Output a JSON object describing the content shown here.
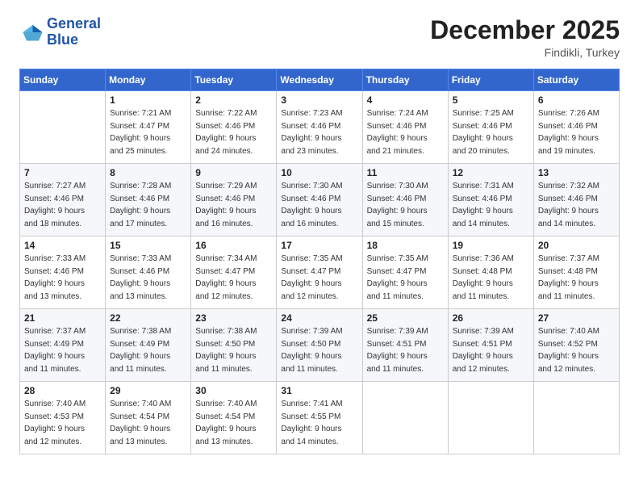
{
  "logo": {
    "line1": "General",
    "line2": "Blue"
  },
  "title": "December 2025",
  "subtitle": "Findikli, Turkey",
  "days_header": [
    "Sunday",
    "Monday",
    "Tuesday",
    "Wednesday",
    "Thursday",
    "Friday",
    "Saturday"
  ],
  "weeks": [
    [
      {
        "day": "",
        "info": ""
      },
      {
        "day": "1",
        "info": "Sunrise: 7:21 AM\nSunset: 4:47 PM\nDaylight: 9 hours\nand 25 minutes."
      },
      {
        "day": "2",
        "info": "Sunrise: 7:22 AM\nSunset: 4:46 PM\nDaylight: 9 hours\nand 24 minutes."
      },
      {
        "day": "3",
        "info": "Sunrise: 7:23 AM\nSunset: 4:46 PM\nDaylight: 9 hours\nand 23 minutes."
      },
      {
        "day": "4",
        "info": "Sunrise: 7:24 AM\nSunset: 4:46 PM\nDaylight: 9 hours\nand 21 minutes."
      },
      {
        "day": "5",
        "info": "Sunrise: 7:25 AM\nSunset: 4:46 PM\nDaylight: 9 hours\nand 20 minutes."
      },
      {
        "day": "6",
        "info": "Sunrise: 7:26 AM\nSunset: 4:46 PM\nDaylight: 9 hours\nand 19 minutes."
      }
    ],
    [
      {
        "day": "7",
        "info": "Sunrise: 7:27 AM\nSunset: 4:46 PM\nDaylight: 9 hours\nand 18 minutes."
      },
      {
        "day": "8",
        "info": "Sunrise: 7:28 AM\nSunset: 4:46 PM\nDaylight: 9 hours\nand 17 minutes."
      },
      {
        "day": "9",
        "info": "Sunrise: 7:29 AM\nSunset: 4:46 PM\nDaylight: 9 hours\nand 16 minutes."
      },
      {
        "day": "10",
        "info": "Sunrise: 7:30 AM\nSunset: 4:46 PM\nDaylight: 9 hours\nand 16 minutes."
      },
      {
        "day": "11",
        "info": "Sunrise: 7:30 AM\nSunset: 4:46 PM\nDaylight: 9 hours\nand 15 minutes."
      },
      {
        "day": "12",
        "info": "Sunrise: 7:31 AM\nSunset: 4:46 PM\nDaylight: 9 hours\nand 14 minutes."
      },
      {
        "day": "13",
        "info": "Sunrise: 7:32 AM\nSunset: 4:46 PM\nDaylight: 9 hours\nand 14 minutes."
      }
    ],
    [
      {
        "day": "14",
        "info": "Sunrise: 7:33 AM\nSunset: 4:46 PM\nDaylight: 9 hours\nand 13 minutes."
      },
      {
        "day": "15",
        "info": "Sunrise: 7:33 AM\nSunset: 4:46 PM\nDaylight: 9 hours\nand 13 minutes."
      },
      {
        "day": "16",
        "info": "Sunrise: 7:34 AM\nSunset: 4:47 PM\nDaylight: 9 hours\nand 12 minutes."
      },
      {
        "day": "17",
        "info": "Sunrise: 7:35 AM\nSunset: 4:47 PM\nDaylight: 9 hours\nand 12 minutes."
      },
      {
        "day": "18",
        "info": "Sunrise: 7:35 AM\nSunset: 4:47 PM\nDaylight: 9 hours\nand 11 minutes."
      },
      {
        "day": "19",
        "info": "Sunrise: 7:36 AM\nSunset: 4:48 PM\nDaylight: 9 hours\nand 11 minutes."
      },
      {
        "day": "20",
        "info": "Sunrise: 7:37 AM\nSunset: 4:48 PM\nDaylight: 9 hours\nand 11 minutes."
      }
    ],
    [
      {
        "day": "21",
        "info": "Sunrise: 7:37 AM\nSunset: 4:49 PM\nDaylight: 9 hours\nand 11 minutes."
      },
      {
        "day": "22",
        "info": "Sunrise: 7:38 AM\nSunset: 4:49 PM\nDaylight: 9 hours\nand 11 minutes."
      },
      {
        "day": "23",
        "info": "Sunrise: 7:38 AM\nSunset: 4:50 PM\nDaylight: 9 hours\nand 11 minutes."
      },
      {
        "day": "24",
        "info": "Sunrise: 7:39 AM\nSunset: 4:50 PM\nDaylight: 9 hours\nand 11 minutes."
      },
      {
        "day": "25",
        "info": "Sunrise: 7:39 AM\nSunset: 4:51 PM\nDaylight: 9 hours\nand 11 minutes."
      },
      {
        "day": "26",
        "info": "Sunrise: 7:39 AM\nSunset: 4:51 PM\nDaylight: 9 hours\nand 12 minutes."
      },
      {
        "day": "27",
        "info": "Sunrise: 7:40 AM\nSunset: 4:52 PM\nDaylight: 9 hours\nand 12 minutes."
      }
    ],
    [
      {
        "day": "28",
        "info": "Sunrise: 7:40 AM\nSunset: 4:53 PM\nDaylight: 9 hours\nand 12 minutes."
      },
      {
        "day": "29",
        "info": "Sunrise: 7:40 AM\nSunset: 4:54 PM\nDaylight: 9 hours\nand 13 minutes."
      },
      {
        "day": "30",
        "info": "Sunrise: 7:40 AM\nSunset: 4:54 PM\nDaylight: 9 hours\nand 13 minutes."
      },
      {
        "day": "31",
        "info": "Sunrise: 7:41 AM\nSunset: 4:55 PM\nDaylight: 9 hours\nand 14 minutes."
      },
      {
        "day": "",
        "info": ""
      },
      {
        "day": "",
        "info": ""
      },
      {
        "day": "",
        "info": ""
      }
    ]
  ]
}
